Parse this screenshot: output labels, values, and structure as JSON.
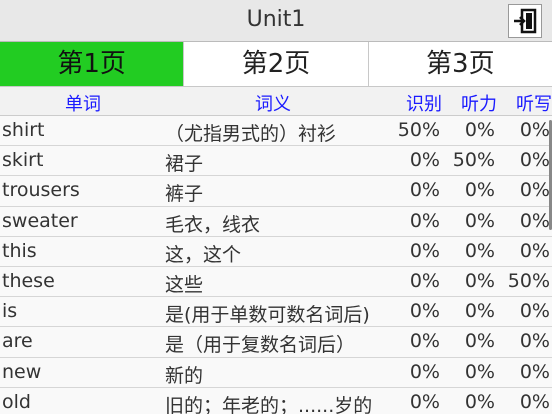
{
  "header": {
    "title": "Unit1",
    "exit_icon": "exit-door-icon"
  },
  "tabs": [
    "第1页",
    "第2页",
    "第3页"
  ],
  "active_tab": 0,
  "columns": {
    "word": "单词",
    "meaning": "词义",
    "recognize": "识别",
    "listen": "听力",
    "dictation": "听写"
  },
  "rows": [
    {
      "word": "shirt",
      "meaning": "（尤指男式的）衬衫",
      "recognize": "50%",
      "listen": "0%",
      "dictation": "0%"
    },
    {
      "word": "skirt",
      "meaning": "裙子",
      "recognize": "0%",
      "listen": "50%",
      "dictation": "0%"
    },
    {
      "word": "trousers",
      "meaning": "裤子",
      "recognize": "0%",
      "listen": "0%",
      "dictation": "0%"
    },
    {
      "word": "sweater",
      "meaning": "毛衣，线衣",
      "recognize": "0%",
      "listen": "0%",
      "dictation": "0%"
    },
    {
      "word": "this",
      "meaning": "这，这个",
      "recognize": "0%",
      "listen": "0%",
      "dictation": "0%"
    },
    {
      "word": "these",
      "meaning": "这些",
      "recognize": "0%",
      "listen": "0%",
      "dictation": "50%"
    },
    {
      "word": "is",
      "meaning": "是(用于单数可数名词后)",
      "recognize": "0%",
      "listen": "0%",
      "dictation": "0%"
    },
    {
      "word": "are",
      "meaning": "是（用于复数名词后）",
      "recognize": "0%",
      "listen": "0%",
      "dictation": "0%"
    },
    {
      "word": "new",
      "meaning": "新的",
      "recognize": "0%",
      "listen": "0%",
      "dictation": "0%"
    },
    {
      "word": "old",
      "meaning": "旧的；年老的；......岁的",
      "recognize": "0%",
      "listen": "0%",
      "dictation": "0%"
    }
  ]
}
